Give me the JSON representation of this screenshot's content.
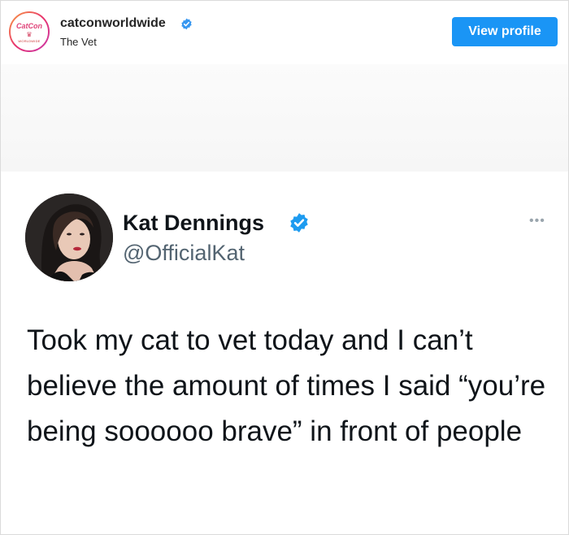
{
  "post": {
    "username": "catconworldwide",
    "subtitle": "The Vet",
    "view_profile_label": "View profile",
    "avatar_logo_text": "CatCon",
    "avatar_sub_text": "WORLDWIDE"
  },
  "tweet": {
    "display_name": "Kat Dennings",
    "handle": "@OfficialKat",
    "text": "Took my cat to vet today and I can’t believe the amount of times I said “you’re being soooooo brave” in front of people"
  },
  "colors": {
    "view_button": "#1a95f5",
    "verified_blue": "#1d9bf0",
    "instagram_verified": "#3797f0"
  },
  "icons": {
    "instagram_verified": "verified-badge-icon",
    "twitter_verified": "verified-badge-icon",
    "more": "more-dots-icon"
  }
}
